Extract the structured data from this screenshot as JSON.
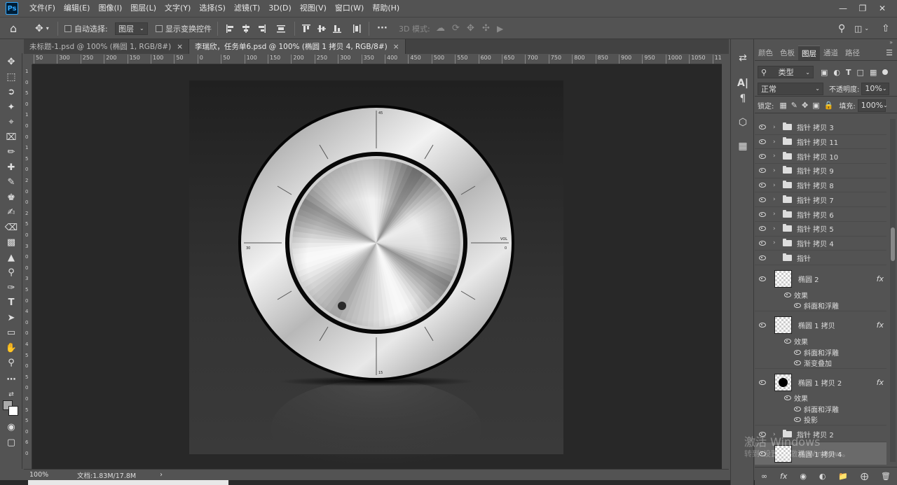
{
  "menu": [
    "文件(F)",
    "编辑(E)",
    "图像(I)",
    "图层(L)",
    "文字(Y)",
    "选择(S)",
    "滤镜(T)",
    "3D(D)",
    "视图(V)",
    "窗口(W)",
    "帮助(H)"
  ],
  "app_logo": "Ps",
  "options": {
    "auto_select_label": "自动选择:",
    "auto_select_value": "图层",
    "show_transform_label": "显示变换控件",
    "mode_3d_label": "3D 模式:",
    "more": "···"
  },
  "tabs": [
    {
      "title": "未标题-1.psd @ 100% (椭圆 1, RGB/8#)",
      "close": "×",
      "active": false
    },
    {
      "title": "李瑞欣，任务单6.psd @ 100% (椭圆 1 拷贝 4, RGB/8#)",
      "close": "×",
      "active": true
    }
  ],
  "ruler_h": [
    "50",
    "300",
    "250",
    "200",
    "150",
    "100",
    "50",
    "0",
    "50",
    "100",
    "150",
    "200",
    "250",
    "300",
    "350",
    "400",
    "450",
    "500",
    "550",
    "600",
    "650",
    "700",
    "750",
    "800",
    "850",
    "900",
    "950",
    "1000",
    "1050",
    "1100"
  ],
  "ruler_v": [
    "1",
    "0",
    "5",
    "0",
    "1",
    "0",
    "0",
    "1",
    "5",
    "0",
    "2",
    "0",
    "0",
    "2",
    "5",
    "0",
    "3",
    "0",
    "0",
    "3",
    "5",
    "0",
    "4",
    "0",
    "0",
    "4",
    "5",
    "0",
    "5",
    "0",
    "0",
    "5",
    "5",
    "0",
    "6",
    "0"
  ],
  "dial": {
    "label_top": "45",
    "label_left": "30",
    "label_right_1": "VOL",
    "label_right_2": "0",
    "label_bottom": "15"
  },
  "status": {
    "zoom": "100%",
    "doc": "文档:1.83M/17.8M",
    "arrow": "›"
  },
  "panel": {
    "tabs": [
      "颜色",
      "色板",
      "图层",
      "通道",
      "路径"
    ],
    "active_tab": "图层",
    "filter_kind": "类型",
    "blend_mode": "正常",
    "opacity_label": "不透明度:",
    "opacity_value": "10%",
    "lock_label": "锁定:",
    "fill_label": "填充:",
    "fill_value": "100%",
    "folders": [
      "指针 拷贝 3",
      "指针 拷贝 11",
      "指针 拷贝 10",
      "指针 拷贝 9",
      "指针 拷贝 8",
      "指针 拷贝 7",
      "指针 拷贝 6",
      "指针 拷贝 5",
      "指针 拷贝 4",
      "指针"
    ],
    "layer_a": {
      "name": "椭圆 2",
      "fx": "fx",
      "effects_label": "效果",
      "effects": [
        "斜面和浮雕"
      ]
    },
    "layer_b": {
      "name": "椭圆 1 拷贝",
      "fx": "fx",
      "effects_label": "效果",
      "effects": [
        "斜面和浮雕",
        "渐变叠加"
      ]
    },
    "layer_c": {
      "name": "椭圆 1 拷贝 2",
      "fx": "fx",
      "effects_label": "效果",
      "effects": [
        "斜面和浮雕",
        "投影"
      ]
    },
    "layer_d": {
      "name": "指针 拷贝 2"
    },
    "layer_e": {
      "name": "椭圆 1 拷贝 4"
    },
    "bottom_icons": [
      "link-icon",
      "fx-icon",
      "mask-icon",
      "adjustment-icon",
      "group-icon",
      "new-layer-icon",
      "trash-icon"
    ]
  },
  "watermark": {
    "line1": "激活 Windows",
    "line2": "转到\"设置\"以激活 Windows。"
  }
}
